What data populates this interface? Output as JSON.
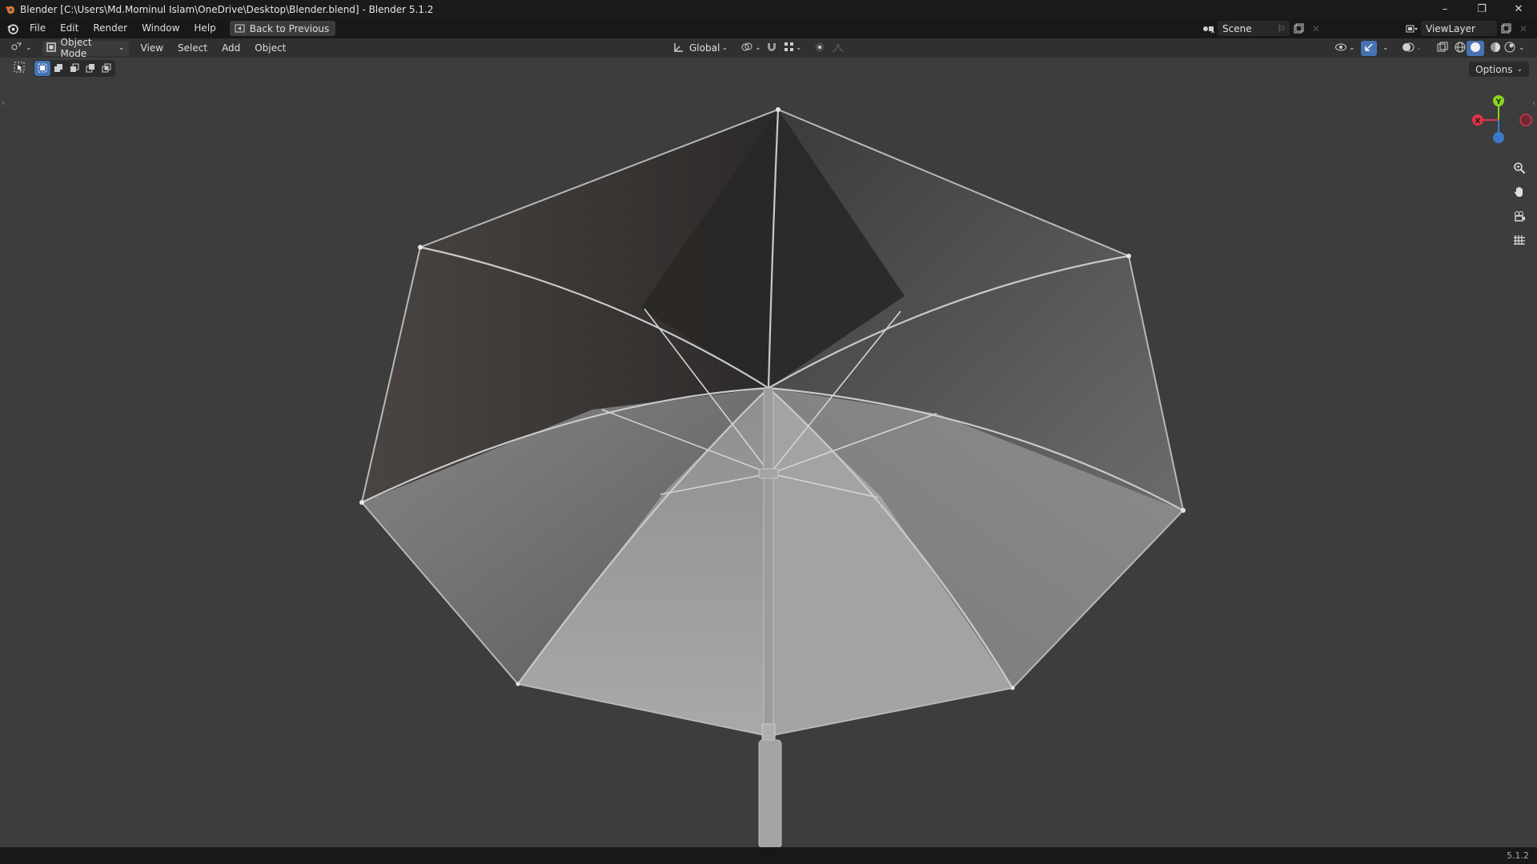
{
  "window": {
    "title": "Blender [C:\\Users\\Md.Mominul Islam\\OneDrive\\Desktop\\Blender.blend] - Blender 5.1.2",
    "controls": [
      "minimize",
      "restore",
      "close"
    ]
  },
  "menubar": {
    "items": [
      "File",
      "Edit",
      "Render",
      "Window",
      "Help"
    ],
    "back_button": "Back to Previous",
    "scene": "Scene",
    "view_layer": "ViewLayer"
  },
  "header": {
    "mode": "Object Mode",
    "menus": [
      "View",
      "Select",
      "Add",
      "Object"
    ],
    "transform_orientation": "Global",
    "options": "Options"
  },
  "gizmo": {
    "x": "X",
    "y": "Y",
    "z": "Z"
  },
  "colors": {
    "x_axis": "#e0334b",
    "y_axis": "#8bd61d",
    "z_axis": "#3b7fd4",
    "accent": "#4772b3"
  },
  "icons": [
    "blender-logo",
    "editor-type-icon",
    "object-mode-icon",
    "select-box-icon",
    "zoom-icon",
    "hand-pan-icon",
    "camera-icon",
    "grid-icon"
  ],
  "statusbar": {
    "version": "5.1.2"
  }
}
